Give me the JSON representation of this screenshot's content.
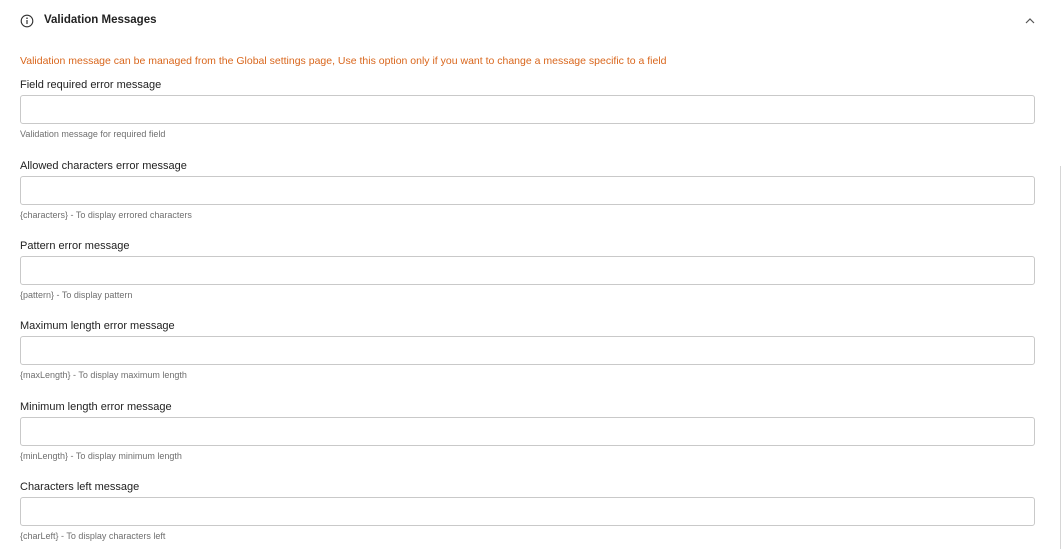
{
  "section": {
    "title": "Validation Messages",
    "icon": "info-icon",
    "toggle_icon": "chevron-up-icon"
  },
  "notice": "Validation message can be managed from the Global settings page, Use this option only if you want to change a message specific to a field",
  "colors": {
    "notice": "#d9661c",
    "border": "#c9c9c9",
    "help": "#6f6f6f"
  },
  "fields": [
    {
      "label": "Field required error message",
      "value": "",
      "help": "Validation message for required field"
    },
    {
      "label": "Allowed characters error message",
      "value": "",
      "help": "{characters} - To display errored characters"
    },
    {
      "label": "Pattern error message",
      "value": "",
      "help": "{pattern} - To display pattern"
    },
    {
      "label": "Maximum length error message",
      "value": "",
      "help": "{maxLength} - To display maximum length"
    },
    {
      "label": "Minimum length error message",
      "value": "",
      "help": "{minLength} - To display minimum length"
    },
    {
      "label": "Characters left message",
      "value": "",
      "help": "{charLeft} - To display characters left"
    }
  ]
}
